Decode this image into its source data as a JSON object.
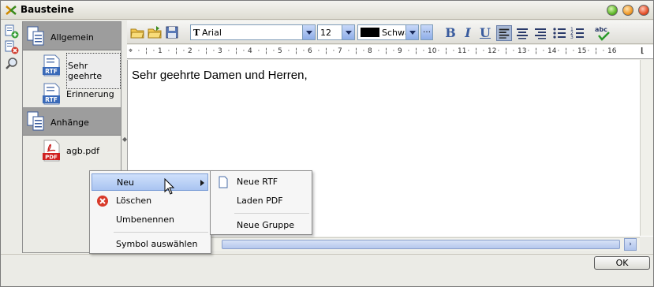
{
  "window": {
    "title": "Bausteine"
  },
  "tree": {
    "groups": [
      {
        "label": "Allgemein",
        "items": [
          {
            "label": "Sehr geehrte",
            "type": "RTF"
          },
          {
            "label": "Erinnerung",
            "type": "RTF"
          }
        ]
      },
      {
        "label": "Anhänge",
        "items": [
          {
            "label": "agb.pdf",
            "type": "PDF"
          }
        ]
      }
    ]
  },
  "toolbar": {
    "font": "Arial",
    "size": "12",
    "color_label": "Schwa",
    "bold": "B",
    "italic": "I",
    "underline": "U",
    "spell": "abc"
  },
  "ruler": {
    "marks": [
      "1",
      "2",
      "3",
      "4",
      "5",
      "6",
      "7",
      "8",
      "9",
      "10",
      "11",
      "12",
      "13",
      "14",
      "15",
      "16"
    ]
  },
  "document": {
    "text": "Sehr geehrte Damen und Herren,"
  },
  "context_menu": {
    "items": [
      {
        "label": "Neu"
      },
      {
        "label": "Löschen"
      },
      {
        "label": "Umbenennen"
      },
      {
        "label": "Symbol auswählen"
      }
    ]
  },
  "submenu": {
    "items": [
      {
        "label": "Neue RTF"
      },
      {
        "label": "Laden PDF"
      },
      {
        "label": "Neue Gruppe"
      }
    ]
  },
  "buttons": {
    "ok": "OK"
  },
  "colors": {
    "highlight": "#a9c4f1",
    "group_bg": "#9d9d9d",
    "accent": "#3a5c9e"
  }
}
